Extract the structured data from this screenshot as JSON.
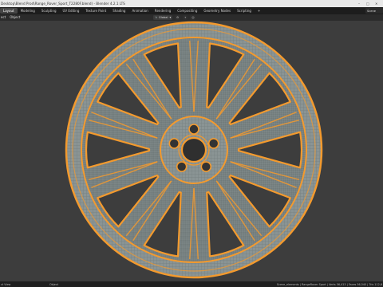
{
  "window": {
    "title": "Desktop\\Blend Prod\\Range_Rover_Sport_T2280F.blend) - Blender 4.2.1 LTS",
    "controls": [
      "–",
      "□",
      "✕"
    ]
  },
  "workspace_tabs": [
    {
      "label": "Layout",
      "active": true
    },
    {
      "label": "Modeling",
      "active": false
    },
    {
      "label": "Sculpting",
      "active": false
    },
    {
      "label": "UV Editing",
      "active": false
    },
    {
      "label": "Texture Paint",
      "active": false
    },
    {
      "label": "Shading",
      "active": false
    },
    {
      "label": "Animation",
      "active": false
    },
    {
      "label": "Rendering",
      "active": false
    },
    {
      "label": "Compositing",
      "active": false
    },
    {
      "label": "Geometry Nodes",
      "active": false
    },
    {
      "label": "Scripting",
      "active": false
    },
    {
      "label": "+",
      "active": false
    }
  ],
  "scene": {
    "label": "Scene"
  },
  "header": {
    "menus": [
      "ect",
      "Object"
    ],
    "transform_orientation": "Global",
    "pivot_icons": [
      "pivot-icon",
      "snap-icon",
      "proportional-icon"
    ]
  },
  "viewport": {
    "object": "wheel rim",
    "mesh_color": "#f39a2e",
    "wire_color": "#7f8c8c"
  },
  "statusbar": {
    "left": "ct View",
    "mid": "Object",
    "right": "Scene_elements | RangeRover Sport | Verts 56,413 | Faces 56,540 | Tris 112,6"
  }
}
